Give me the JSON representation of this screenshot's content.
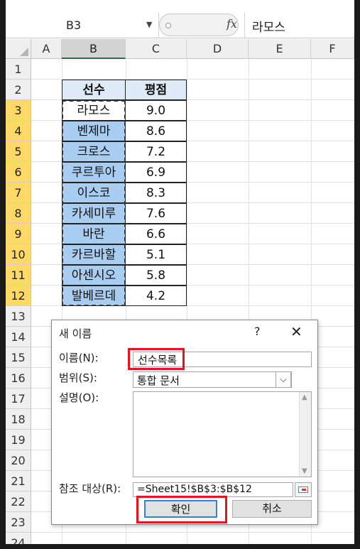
{
  "name_box": "B3",
  "formula_content": "라모스",
  "columns": [
    "A",
    "B",
    "C",
    "D",
    "E",
    "F"
  ],
  "rows": [
    "1",
    "2",
    "3",
    "4",
    "5",
    "6",
    "7",
    "8",
    "9",
    "10",
    "11",
    "12",
    "13",
    "14",
    "15",
    "16",
    "17",
    "18",
    "19",
    "20",
    "21",
    "22",
    "23",
    "24"
  ],
  "table": {
    "header": [
      "선수",
      "평점"
    ],
    "players": [
      "라모스",
      "벤제마",
      "크로스",
      "쿠르투아",
      "이스코",
      "카세미루",
      "바란",
      "카르바할",
      "아센시오",
      "발베르데"
    ],
    "scores": [
      "9.0",
      "8.6",
      "7.2",
      "6.9",
      "8.3",
      "7.6",
      "6.6",
      "5.1",
      "5.8",
      "4.2"
    ]
  },
  "dialog": {
    "title": "새 이름",
    "help": "?",
    "close": "✕",
    "name_label": "이름(N):",
    "name_value": "선수목록",
    "scope_label": "범위(S):",
    "scope_value": "통합 문서",
    "comment_label": "설명(O):",
    "ref_label": "참조 대상(R):",
    "ref_value": "=Sheet15!$B$3:$B$12",
    "ok": "확인",
    "cancel": "취소"
  },
  "colors": {
    "header_fill": "#deeaf6",
    "player_fill": "#a9cdf0",
    "highlight": "#e8141b",
    "selected_row": "#ffd966"
  }
}
